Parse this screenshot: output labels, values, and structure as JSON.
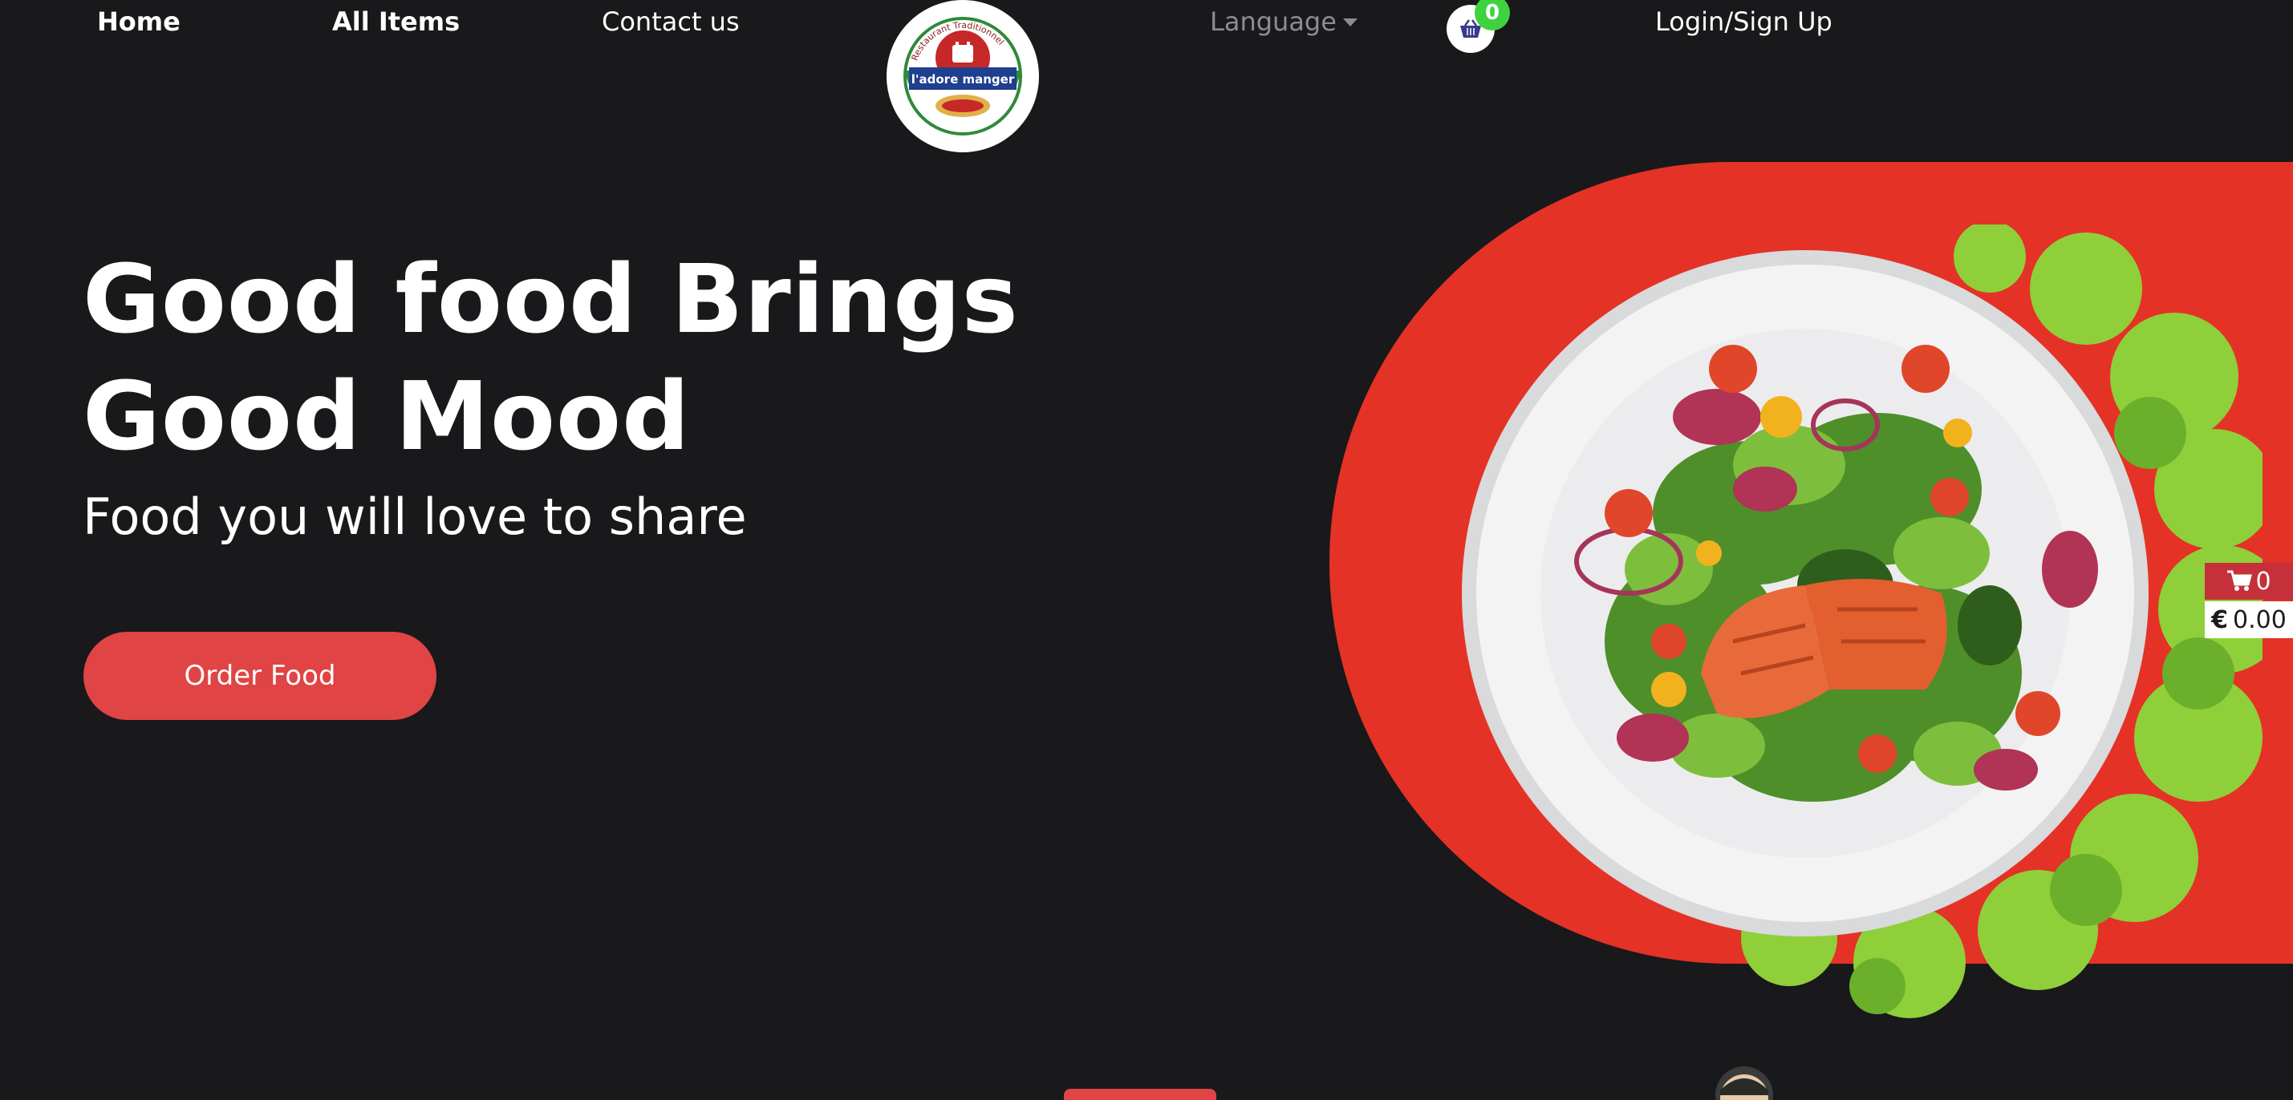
{
  "nav": {
    "home": "Home",
    "all_items": "All Items",
    "contact": "Contact us",
    "language": "Language",
    "login": "Login/Sign Up",
    "basket_count": "0"
  },
  "logo": {
    "text": "l'adore manger",
    "ring_text": "Restaurant Traditionnel"
  },
  "hero": {
    "title_line1": "Good food Brings",
    "title_line2": "Good Mood",
    "subtitle": "Food you will love to share",
    "cta": "Order Food"
  },
  "side_cart": {
    "count": "0",
    "currency": "€",
    "total": "0.00"
  },
  "colors": {
    "background": "#19181a",
    "accent_red": "#e53226",
    "button_red": "#e04444",
    "badge_green": "#3fd23f"
  },
  "icons": [
    "basket-icon",
    "cart-icon",
    "caret-down-icon"
  ]
}
